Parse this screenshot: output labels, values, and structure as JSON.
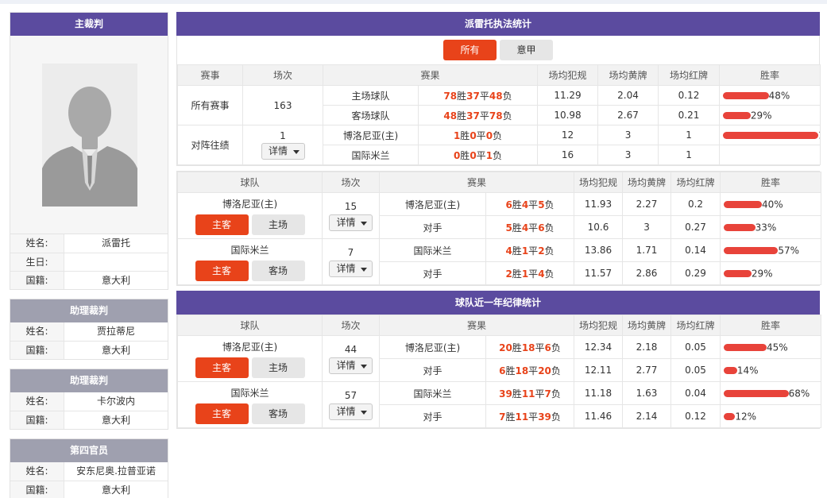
{
  "referee": {
    "header": "主裁判",
    "rows": [
      {
        "label": "姓名:",
        "value": "派雷托"
      },
      {
        "label": "生日:",
        "value": ""
      },
      {
        "label": "国籍:",
        "value": "意大利"
      }
    ]
  },
  "assistant1": {
    "header": "助理裁判",
    "rows": [
      {
        "label": "姓名:",
        "value": "贾拉蒂尼"
      },
      {
        "label": "国籍:",
        "value": "意大利"
      }
    ]
  },
  "assistant2": {
    "header": "助理裁判",
    "rows": [
      {
        "label": "姓名:",
        "value": "卡尔波内"
      },
      {
        "label": "国籍:",
        "value": "意大利"
      }
    ]
  },
  "fourth": {
    "header": "第四官员",
    "rows": [
      {
        "label": "姓名:",
        "value": "安东尼奥.拉普亚诺"
      },
      {
        "label": "国籍:",
        "value": "意大利"
      }
    ]
  },
  "stats": {
    "title": "派雷托执法统计",
    "tabs": [
      "所有",
      "意甲"
    ],
    "headers": [
      "赛事",
      "场次",
      "赛果",
      "场均犯规",
      "场均黄牌",
      "场均红牌",
      "胜率"
    ],
    "groups": [
      {
        "name": "所有赛事",
        "matches": "163",
        "has_detail": false,
        "rows": [
          {
            "team": "主场球队",
            "w": "78",
            "d": "37",
            "l": "48",
            "fouls": "11.29",
            "yellow": "2.04",
            "red": "0.12",
            "rate": 48,
            "rate_label": "48%"
          },
          {
            "team": "客场球队",
            "w": "48",
            "d": "37",
            "l": "78",
            "fouls": "10.98",
            "yellow": "2.67",
            "red": "0.21",
            "rate": 29,
            "rate_label": "29%"
          }
        ]
      },
      {
        "name": "对阵往绩",
        "matches": "1",
        "has_detail": true,
        "rows": [
          {
            "team": "博洛尼亚(主)",
            "w": "1",
            "d": "0",
            "l": "0",
            "fouls": "12",
            "yellow": "3",
            "red": "1",
            "rate": 100,
            "rate_label": "100%"
          },
          {
            "team": "国际米兰",
            "w": "0",
            "d": "0",
            "l": "1",
            "fouls": "16",
            "yellow": "3",
            "red": "1",
            "rate": null,
            "rate_label": ""
          }
        ]
      }
    ]
  },
  "team_stats": {
    "headers": [
      "球队",
      "场次",
      "赛果",
      "场均犯规",
      "场均黄牌",
      "场均红牌",
      "胜率"
    ],
    "groups": [
      {
        "team": "博洛尼亚(主)",
        "btn1": "主客",
        "btn2": "主场",
        "matches": "15",
        "rows": [
          {
            "team": "博洛尼亚(主)",
            "w": "6",
            "d": "4",
            "l": "5",
            "fouls": "11.93",
            "yellow": "2.27",
            "red": "0.2",
            "rate": 40,
            "rate_label": "40%"
          },
          {
            "team": "对手",
            "w": "5",
            "d": "4",
            "l": "6",
            "fouls": "10.6",
            "yellow": "3",
            "red": "0.27",
            "rate": 33,
            "rate_label": "33%"
          }
        ]
      },
      {
        "team": "国际米兰",
        "btn1": "主客",
        "btn2": "客场",
        "matches": "7",
        "rows": [
          {
            "team": "国际米兰",
            "w": "4",
            "d": "1",
            "l": "2",
            "fouls": "13.86",
            "yellow": "1.71",
            "red": "0.14",
            "rate": 57,
            "rate_label": "57%"
          },
          {
            "team": "对手",
            "w": "2",
            "d": "1",
            "l": "4",
            "fouls": "11.57",
            "yellow": "2.86",
            "red": "0.29",
            "rate": 29,
            "rate_label": "29%"
          }
        ]
      }
    ]
  },
  "year_stats": {
    "title": "球队近一年纪律统计",
    "headers": [
      "球队",
      "场次",
      "赛果",
      "场均犯规",
      "场均黄牌",
      "场均红牌",
      "胜率"
    ],
    "groups": [
      {
        "team": "博洛尼亚(主)",
        "btn1": "主客",
        "btn2": "主场",
        "matches": "44",
        "rows": [
          {
            "team": "博洛尼亚(主)",
            "w": "20",
            "d": "18",
            "l": "6",
            "fouls": "12.34",
            "yellow": "2.18",
            "red": "0.05",
            "rate": 45,
            "rate_label": "45%"
          },
          {
            "team": "对手",
            "w": "6",
            "d": "18",
            "l": "20",
            "fouls": "12.11",
            "yellow": "2.77",
            "red": "0.05",
            "rate": 14,
            "rate_label": "14%"
          }
        ]
      },
      {
        "team": "国际米兰",
        "btn1": "主客",
        "btn2": "客场",
        "matches": "57",
        "rows": [
          {
            "team": "国际米兰",
            "w": "39",
            "d": "11",
            "l": "7",
            "fouls": "11.18",
            "yellow": "1.63",
            "red": "0.04",
            "rate": 68,
            "rate_label": "68%"
          },
          {
            "team": "对手",
            "w": "7",
            "d": "11",
            "l": "39",
            "fouls": "11.46",
            "yellow": "2.14",
            "red": "0.12",
            "rate": 12,
            "rate_label": "12%"
          }
        ]
      }
    ]
  },
  "labels": {
    "detail": "详情",
    "win": "胜",
    "draw": "平",
    "loss": "负"
  },
  "colors": {
    "header_purple": "#5b4b9f",
    "sub_grey": "#9fa0af",
    "accent_red": "#e8431a",
    "bar_red": "#e8433a"
  }
}
